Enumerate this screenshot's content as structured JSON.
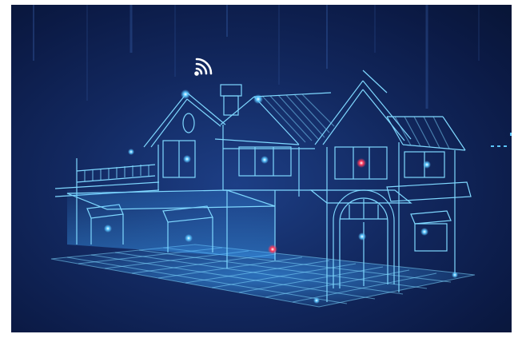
{
  "image": {
    "subject": "smart-home-wireframe-illustration",
    "colors": {
      "background_dark": "#0b1a45",
      "background_mid": "#1d3f86",
      "line": "#7fd8ff",
      "glow": "#3fa7ff",
      "node_blue": "#5cc6ff",
      "node_red": "#ff3b5c",
      "wifi": "#ffffff"
    },
    "icons": [
      "wifi-icon"
    ],
    "sensor_nodes": {
      "blue": 12,
      "red": 2
    }
  }
}
